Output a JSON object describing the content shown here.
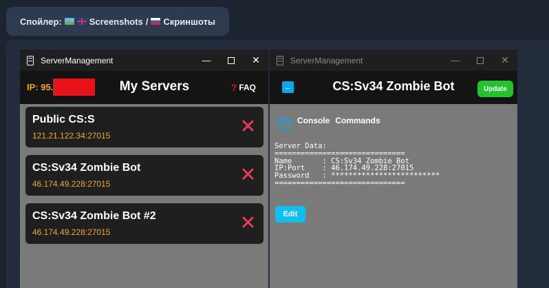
{
  "spoiler": {
    "label": "Спойлер:",
    "title_en": "Screenshots",
    "separator": "/",
    "title_ru": "Скриншоты"
  },
  "left_window": {
    "title": "ServerManagement",
    "ip_label": "IP: 95.",
    "page_title": "My Servers",
    "faq_icon": "?",
    "faq_label": "FAQ",
    "servers": [
      {
        "name": "Public CS:S",
        "address": "121.21.122.34:27015"
      },
      {
        "name": "CS:Sv34 Zombie Bot",
        "address": "46.174.49.228:27015"
      },
      {
        "name": "CS:Sv34 Zombie Bot #2",
        "address": "46.174.49.228:27015"
      }
    ]
  },
  "right_window": {
    "title": "ServerManagement",
    "page_title": "CS:Sv34 Zombie Bot",
    "update_label": "Update",
    "tabs": [
      "Info",
      "Console",
      "Commands"
    ],
    "info_lines": [
      "Server Data:",
      "==============================",
      "Name       : CS:Sv34 Zombie Bot",
      "IP:Port    : 46.174.49.228:27015",
      "Password   : *************************",
      "=============================="
    ],
    "edit_label": "Edit"
  },
  "window_controls": {
    "minimize": "—",
    "close": "✕"
  },
  "colors": {
    "accent_orange": "#f5a623",
    "accent_blue": "#0ea5e9",
    "delete_red": "#e8395a",
    "update_green": "#22c32c",
    "redaction_red": "#e8121b"
  }
}
